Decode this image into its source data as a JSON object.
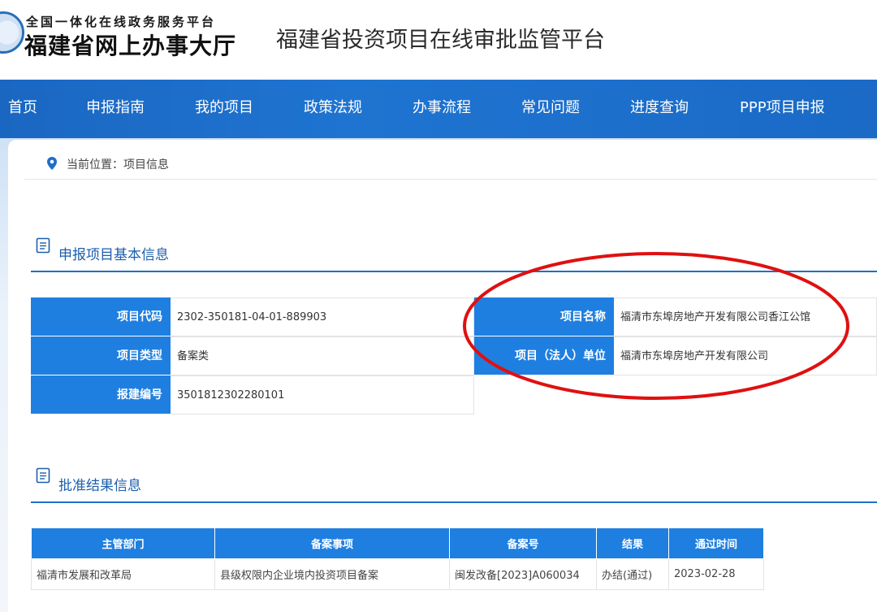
{
  "header": {
    "brand_top": "全国一体化在线政务服务平台",
    "brand_main": "福建省网上办事大厅",
    "platform_title": "福建省投资项目在线审批监管平台"
  },
  "nav": {
    "items": [
      "首页",
      "申报指南",
      "我的项目",
      "政策法规",
      "办事流程",
      "常见问题",
      "进度查询",
      "PPP项目申报"
    ]
  },
  "breadcrumb": {
    "text": "当前位置：项目信息"
  },
  "basic_info": {
    "title": "申报项目基本信息",
    "fields": [
      {
        "label": "项目代码",
        "value": "2302-350181-04-01-889903"
      },
      {
        "label": "项目类型",
        "value": "备案类"
      },
      {
        "label": "报建编号",
        "value": "3501812302280101"
      },
      {
        "label": "项目名称",
        "value": "福清市东埠房地产开发有限公司香江公馆"
      },
      {
        "label": "项目（法人）单位",
        "value": "福清市东埠房地产开发有限公司"
      }
    ]
  },
  "approval": {
    "title": "批准结果信息",
    "columns": [
      "主管部门",
      "备案事项",
      "备案号",
      "结果",
      "通过时间"
    ],
    "rows": [
      [
        "福清市发展和改革局",
        "县级权限内企业境内投资项目备案",
        "闽发改备[2023]A060034",
        "办结(通过)",
        "2023-02-28"
      ]
    ]
  },
  "colors": {
    "nav_blue": "#1a67c2",
    "label_blue": "#1f7fe0",
    "annotation_red": "#e01010"
  },
  "icons": [
    "emblem-logo",
    "location-pin-icon",
    "document-icon"
  ]
}
